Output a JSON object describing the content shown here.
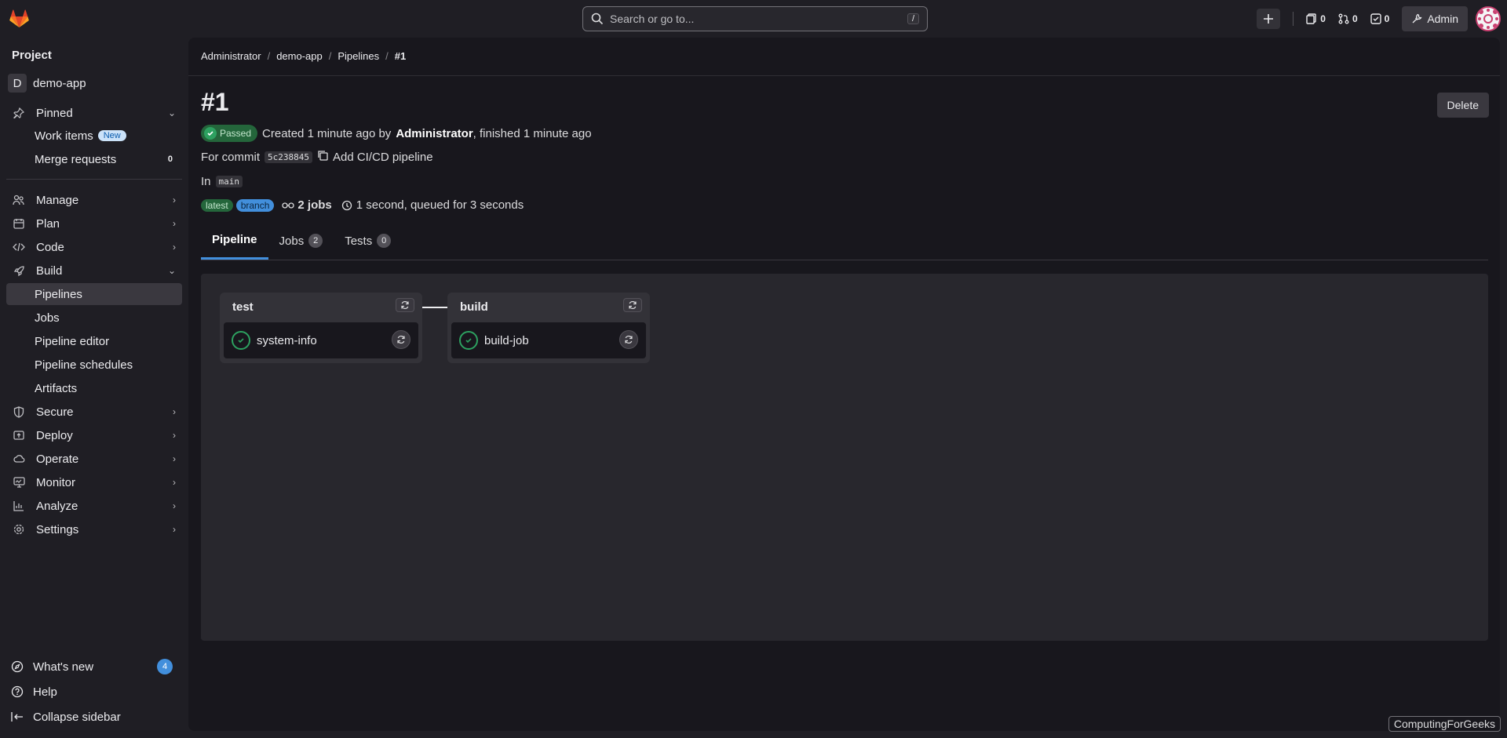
{
  "topbar": {
    "search_placeholder": "Search or go to...",
    "search_shortcut": "/",
    "issues_count": "0",
    "merge_requests_count": "0",
    "todos_count": "0",
    "admin_label": "Admin"
  },
  "sidebar": {
    "heading": "Project",
    "project_initial": "D",
    "project_name": "demo-app",
    "pinned_label": "Pinned",
    "pinned_items": [
      {
        "label": "Work items",
        "badge": "New"
      },
      {
        "label": "Merge requests",
        "count": "0"
      }
    ],
    "sections": [
      {
        "label": "Manage"
      },
      {
        "label": "Plan"
      },
      {
        "label": "Code"
      },
      {
        "label": "Build"
      }
    ],
    "build_items": [
      {
        "label": "Pipelines"
      },
      {
        "label": "Jobs"
      },
      {
        "label": "Pipeline editor"
      },
      {
        "label": "Pipeline schedules"
      },
      {
        "label": "Artifacts"
      }
    ],
    "more_sections": [
      {
        "label": "Secure"
      },
      {
        "label": "Deploy"
      },
      {
        "label": "Operate"
      },
      {
        "label": "Monitor"
      },
      {
        "label": "Analyze"
      },
      {
        "label": "Settings"
      }
    ],
    "footer": {
      "whats_new": "What's new",
      "whats_new_count": "4",
      "help": "Help",
      "collapse": "Collapse sidebar"
    }
  },
  "breadcrumb": [
    "Administrator",
    "demo-app",
    "Pipelines",
    "#1"
  ],
  "pipeline": {
    "title": "#1",
    "delete_label": "Delete",
    "status": "Passed",
    "created_text": "Created 1 minute ago by",
    "author": "Administrator",
    "finished_text": ", finished 1 minute ago",
    "commit_prefix": "For commit",
    "commit_sha": "5c238845",
    "commit_message": "Add CI/CD pipeline",
    "branch_prefix": "In",
    "branch": "main",
    "tag_latest": "latest",
    "tag_branch": "branch",
    "jobs_summary": "2 jobs",
    "duration": "1 second, queued for 3 seconds"
  },
  "tabs": [
    {
      "label": "Pipeline"
    },
    {
      "label": "Jobs",
      "count": "2"
    },
    {
      "label": "Tests",
      "count": "0"
    }
  ],
  "stages": [
    {
      "name": "test",
      "job": "system-info"
    },
    {
      "name": "build",
      "job": "build-job"
    }
  ],
  "watermark": "ComputingForGeeks",
  "colors": {
    "success": "#2da160",
    "accent": "#428fdc",
    "background": "#1f1e24"
  }
}
